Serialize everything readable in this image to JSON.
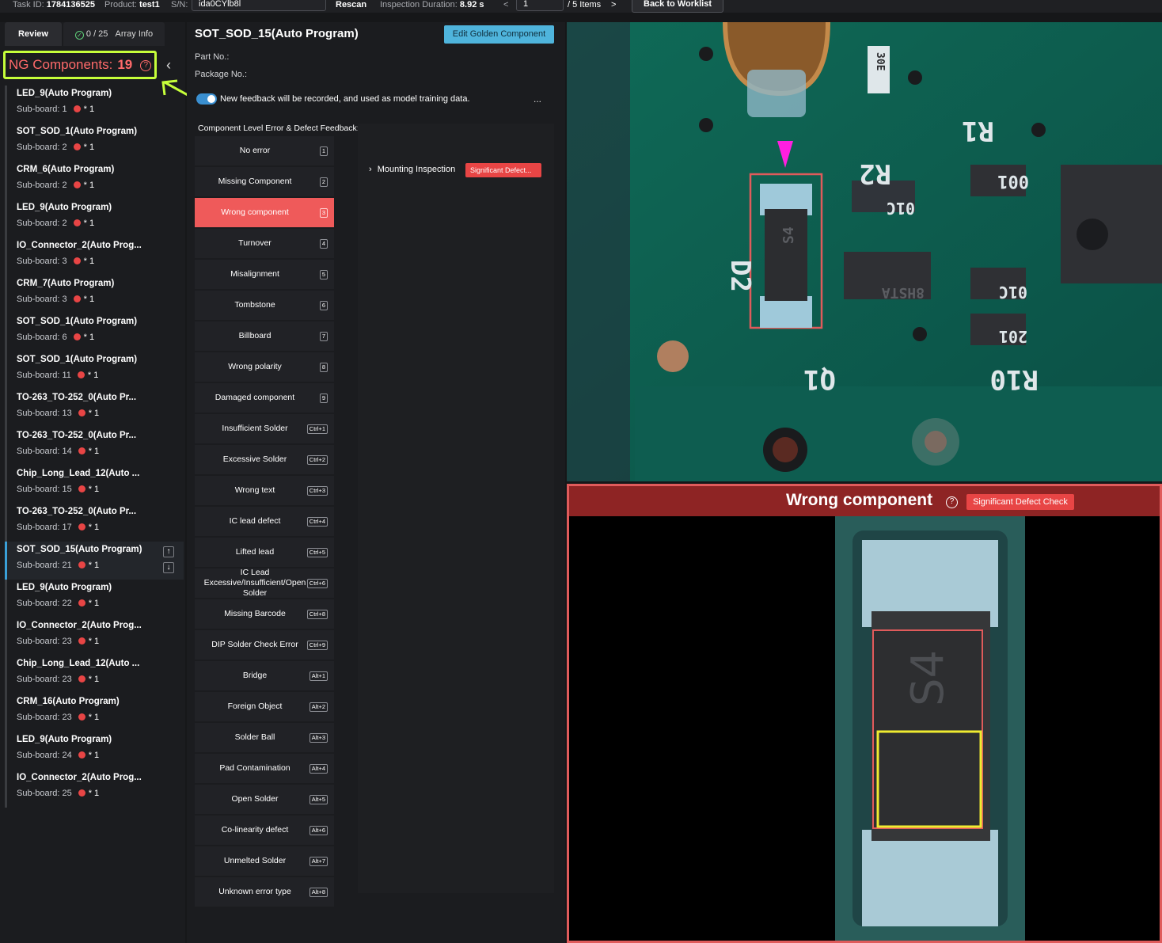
{
  "topbar": {
    "task_label": "Task ID:",
    "task_id": "1784136525",
    "product_label": "Product:",
    "product": "test1",
    "sn_label": "S/N:",
    "sn_value": "ida0CYlb8l",
    "rescan": "Rescan",
    "duration_label": "Inspection Duration:",
    "duration": "8.92 s",
    "prev": "<",
    "page": "1",
    "items": "/ 5 Items",
    "next": ">",
    "back": "Back to Worklist"
  },
  "left": {
    "tab_review": "Review",
    "tab_progress": "0 / 25",
    "tab_array": "Array Info",
    "ng_label": "NG Components:",
    "ng_count": "19",
    "items": [
      {
        "name": "LED_9(Auto Program)",
        "sub": "Sub-board: 1",
        "mult": "* 1"
      },
      {
        "name": "SOT_SOD_1(Auto Program)",
        "sub": "Sub-board: 2",
        "mult": "* 1"
      },
      {
        "name": "CRM_6(Auto Program)",
        "sub": "Sub-board: 2",
        "mult": "* 1"
      },
      {
        "name": "LED_9(Auto Program)",
        "sub": "Sub-board: 2",
        "mult": "* 1"
      },
      {
        "name": "IO_Connector_2(Auto Prog...",
        "sub": "Sub-board: 3",
        "mult": "* 1"
      },
      {
        "name": "CRM_7(Auto Program)",
        "sub": "Sub-board: 3",
        "mult": "* 1"
      },
      {
        "name": "SOT_SOD_1(Auto Program)",
        "sub": "Sub-board: 6",
        "mult": "* 1"
      },
      {
        "name": "SOT_SOD_1(Auto Program)",
        "sub": "Sub-board: 11",
        "mult": "* 1"
      },
      {
        "name": "TO-263_TO-252_0(Auto Pr...",
        "sub": "Sub-board: 13",
        "mult": "* 1"
      },
      {
        "name": "TO-263_TO-252_0(Auto Pr...",
        "sub": "Sub-board: 14",
        "mult": "* 1"
      },
      {
        "name": "Chip_Long_Lead_12(Auto ...",
        "sub": "Sub-board: 15",
        "mult": "* 1"
      },
      {
        "name": "TO-263_TO-252_0(Auto Pr...",
        "sub": "Sub-board: 17",
        "mult": "* 1"
      },
      {
        "name": "SOT_SOD_15(Auto Program)",
        "sub": "Sub-board: 21",
        "mult": "* 1"
      },
      {
        "name": "LED_9(Auto Program)",
        "sub": "Sub-board: 22",
        "mult": "* 1"
      },
      {
        "name": "IO_Connector_2(Auto Prog...",
        "sub": "Sub-board: 23",
        "mult": "* 1"
      },
      {
        "name": "Chip_Long_Lead_12(Auto ...",
        "sub": "Sub-board: 23",
        "mult": "* 1"
      },
      {
        "name": "CRM_16(Auto Program)",
        "sub": "Sub-board: 23",
        "mult": "* 1"
      },
      {
        "name": "LED_9(Auto Program)",
        "sub": "Sub-board: 24",
        "mult": "* 1"
      },
      {
        "name": "IO_Connector_2(Auto Prog...",
        "sub": "Sub-board: 25",
        "mult": "* 1"
      }
    ]
  },
  "middle": {
    "title": "SOT_SOD_15(Auto Program)",
    "edit_golden": "Edit Golden Component",
    "part_no": "Part No.:",
    "package_no": "Package No.:",
    "feedback_note": "New feedback will be recorded, and used as model training data.",
    "more": "...",
    "section_label": "Component Level Error & Defect Feedback:",
    "errors": [
      {
        "label": "No error",
        "key": "1"
      },
      {
        "label": "Missing Component",
        "key": "2"
      },
      {
        "label": "Wrong component",
        "key": "3"
      },
      {
        "label": "Turnover",
        "key": "4"
      },
      {
        "label": "Misalignment",
        "key": "5"
      },
      {
        "label": "Tombstone",
        "key": "6"
      },
      {
        "label": "Billboard",
        "key": "7"
      },
      {
        "label": "Wrong polarity",
        "key": "8"
      },
      {
        "label": "Damaged component",
        "key": "9"
      },
      {
        "label": "Insufficient Solder",
        "key": "Ctrl+1"
      },
      {
        "label": "Excessive Solder",
        "key": "Ctrl+2"
      },
      {
        "label": "Wrong text",
        "key": "Ctrl+3"
      },
      {
        "label": "IC lead defect",
        "key": "Ctrl+4"
      },
      {
        "label": "Lifted lead",
        "key": "Ctrl+5"
      },
      {
        "label": "IC Lead Excessive/Insufficient/Open Solder",
        "key": "Ctrl+6"
      },
      {
        "label": "Missing Barcode",
        "key": "Ctrl+8"
      },
      {
        "label": "DIP Solder Check Error",
        "key": "Ctrl+9"
      },
      {
        "label": "Bridge",
        "key": "Alt+1"
      },
      {
        "label": "Foreign Object",
        "key": "Alt+2"
      },
      {
        "label": "Solder Ball",
        "key": "Alt+3"
      },
      {
        "label": "Pad Contamination",
        "key": "Alt+4"
      },
      {
        "label": "Open Solder",
        "key": "Alt+5"
      },
      {
        "label": "Co-linearity defect",
        "key": "Alt+6"
      },
      {
        "label": "Unmelted Solder",
        "key": "Alt+7"
      },
      {
        "label": "Unknown error type",
        "key": "Alt+8"
      }
    ],
    "mounting": "Mounting Inspection",
    "sig_badge": "Significant Defect..."
  },
  "pcb": {
    "labels": [
      "D2",
      "R2",
      "R1",
      "Q1",
      "R10",
      "001",
      "01C",
      "01C",
      "201",
      "S4",
      "8HSTA",
      "30E"
    ]
  },
  "defect": {
    "title": "Wrong component",
    "badge": "Significant Defect Check",
    "marking": "S4"
  },
  "colors": {
    "accent": "#4fb4dc",
    "ng": "#ff6a6a",
    "highlight": "#c6ff3a",
    "error": "#e84545"
  }
}
